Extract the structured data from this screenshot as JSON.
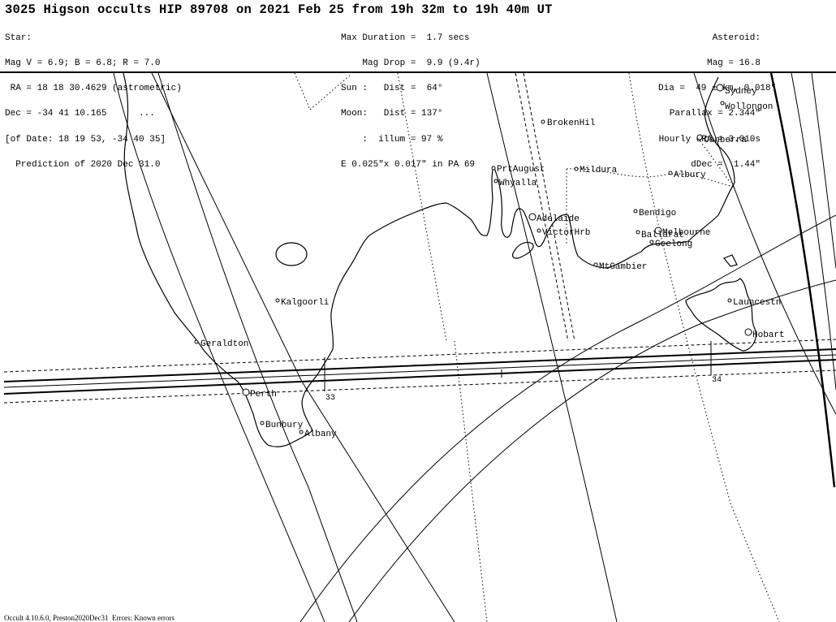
{
  "title": "3025 Higson occults HIP 89708 on 2021 Feb 25 from 19h 32m to 19h 40m UT",
  "star_block": [
    "Star:",
    "Mag V = 6.9; B = 6.8; R = 7.0",
    " RA = 18 18 30.4629 (astrometric)",
    "Dec = -34 41 10.165      ...",
    "[of Date: 18 19 53, -34 40 35]",
    "  Prediction of 2020 Dec 31.0"
  ],
  "event_block": [
    "Max Duration =  1.7 secs",
    "    Mag Drop =  9.9 (9.4r)",
    "Sun :   Dist =  64°",
    "Moon:   Dist = 137°",
    "    :  illum = 97 %",
    "E 0.025\"x 0.017\" in PA 69"
  ],
  "asteroid_block": [
    "Asteroid:",
    "Mag = 16.8",
    "Dia =  49 ±3km, 0.018\"",
    "Parallax = 2.344\"",
    "Hourly dRA = 3.010s",
    "dDec =  1.44\""
  ],
  "cities": {
    "sydney": "Sydney",
    "wollongon": "Wollongon",
    "brokenhil": "BrokenHil",
    "canberra": "Canberra",
    "prtaugust": "PrtAugust",
    "mildura": "Mildura",
    "albury": "Albury",
    "whyalla": "Whyalla",
    "adelaide": "Adelaide",
    "bendigo": "Bendigo",
    "victorhrb": "VictorHrb",
    "ballarat": "Ballarat",
    "melbourne": "Melbourne",
    "geelong": "Geelong",
    "mtgambier": "MtGambier",
    "kalgoorli": "Kalgoorli",
    "launcestn": "Launcestn",
    "hobart": "Hobart",
    "geraldton": "Geraldton",
    "perth": "Perth",
    "bunbury": "Bunbury",
    "albany": "Albany"
  },
  "time_ticks": {
    "t33": "33",
    "t34": "34"
  },
  "footer": "Occult 4.10.6.0, Preston2020Dec31  Errors: Known errors"
}
